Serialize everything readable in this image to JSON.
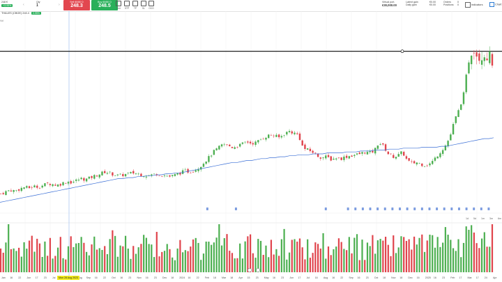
{
  "toolbar": {
    "account_badge": "248 €",
    "account_change": "+3.95%",
    "qty_label": "Qty",
    "qty_value": "1",
    "sell_label": "Sell 60/80 D",
    "sell_price": "248.3",
    "buy_label": "Buy 60/80 D",
    "buy_price": "248.5",
    "icons": [
      {
        "name": "order-type-icon",
        "label": "Lmt"
      },
      {
        "name": "stp-icon",
        "label": "STP"
      },
      {
        "name": "tp-icon",
        "label": "TP"
      },
      {
        "name": "sl-icon",
        "label": "SL"
      },
      {
        "name": "oco-icon",
        "label": "OCO"
      }
    ],
    "virtual_port_label": "Virtual port.",
    "virtual_port_value": "€30,000.00",
    "latent_gain_label": "Latent gain",
    "latent_gain_value": "€0.00",
    "daily_gain_label": "Daily gain",
    "daily_gain_value": "€0.00",
    "orders_label": "Orders",
    "orders_value": "0",
    "positions_label": "Positions",
    "positions_value": "0",
    "indicators_label": "Indicators",
    "chart_label": "Chart"
  },
  "legend": {
    "symbol": "THALES (CBOE)",
    "price": "248.4",
    "change": "3.95%"
  },
  "volume_label": "Vol",
  "timeframes": [
    "1d",
    "5d",
    "1m",
    "3m",
    "6m"
  ],
  "axis": {
    "highlight_date": "Mon 28 Aug 2023",
    "ticks": [
      "Jan",
      "16",
      "22",
      "Jun",
      "17",
      "23",
      "Jul",
      "17",
      "24",
      "Aug",
      "Sep",
      "16",
      "22",
      "Oct",
      "16",
      "23",
      "Nov",
      "16",
      "23",
      "Dec",
      "18",
      "2024",
      "16",
      "22",
      "Feb",
      "18",
      "Mar",
      "18",
      "Apr",
      "15",
      "23",
      "May",
      "16",
      "23",
      "Jun",
      "17",
      "Jul",
      "16",
      "Aug",
      "16",
      "22",
      "Sep",
      "16",
      "23",
      "Oct",
      "18",
      "Nov",
      "18",
      "Dec",
      "16",
      "2025",
      "16",
      "23",
      "Feb",
      "17",
      "Mar",
      "17",
      "24",
      "Apr"
    ]
  },
  "colors": {
    "up": "#4caf50",
    "down": "#e0444c",
    "ma": "#3b6fd6",
    "hline": "#222222",
    "badge": "#29b05a"
  },
  "chart_data": {
    "type": "candlestick",
    "title": "THALES (CBOE)",
    "last_price": 248.4,
    "change_pct": 3.95,
    "price_range": [
      95,
      290
    ],
    "horizontal_line": 258,
    "close_series": [
      108,
      110,
      112,
      111,
      113,
      115,
      114,
      116,
      115,
      117,
      119,
      118,
      117,
      119,
      121,
      120,
      122,
      124,
      123,
      125,
      127,
      129,
      131,
      130,
      128,
      127,
      128,
      129,
      130,
      129,
      128,
      127,
      128,
      129,
      128,
      127,
      126,
      128,
      130,
      132,
      131,
      133,
      136,
      141,
      146,
      152,
      156,
      160,
      159,
      157,
      158,
      160,
      163,
      161,
      162,
      165,
      168,
      170,
      169,
      167,
      171,
      174,
      172,
      170,
      156,
      154,
      152,
      148,
      146,
      147,
      144,
      146,
      145,
      147,
      148,
      149,
      150,
      152,
      151,
      153,
      162,
      158,
      150,
      147,
      148,
      152,
      143,
      140,
      141,
      139,
      138,
      140,
      146,
      152,
      158,
      167,
      185,
      197,
      214,
      250,
      265,
      252,
      256,
      254,
      248
    ],
    "ma_series": [
      99,
      100,
      101,
      102,
      103,
      104,
      105,
      106,
      107,
      108,
      109,
      110,
      111,
      112,
      113,
      114,
      115,
      116,
      117,
      118,
      119,
      120,
      121,
      122,
      123,
      124,
      124,
      125,
      125,
      126,
      126,
      127,
      127,
      128,
      128,
      129,
      129,
      130,
      130,
      131,
      132,
      133,
      134,
      135,
      136,
      137,
      138,
      139,
      140,
      141,
      141,
      142,
      143,
      143,
      144,
      145,
      145,
      146,
      146,
      147,
      147,
      148,
      148,
      149,
      149,
      149,
      150,
      150,
      150,
      151,
      151,
      151,
      151,
      152,
      152,
      152,
      153,
      153,
      153,
      154,
      154,
      154,
      155,
      155,
      155,
      156,
      156,
      156,
      156,
      157,
      157,
      157,
      157,
      158,
      158,
      159,
      160,
      161,
      162,
      163,
      164,
      165,
      166,
      166,
      167
    ]
  }
}
